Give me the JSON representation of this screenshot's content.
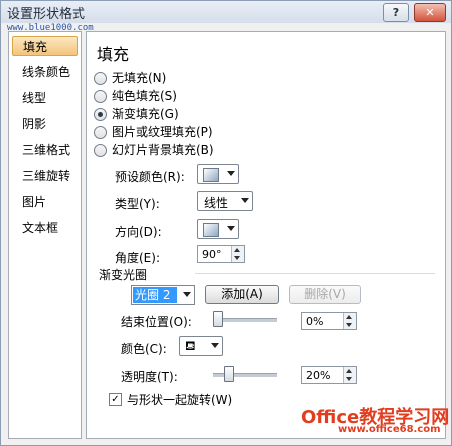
{
  "window": {
    "title": "设置形状格式",
    "url": "www.blue1000.com"
  },
  "titlebar": {
    "help": "?",
    "close": "✕"
  },
  "nav": {
    "items": [
      {
        "label": "填充",
        "selected": true
      },
      {
        "label": "线条颜色"
      },
      {
        "label": "线型"
      },
      {
        "label": "阴影"
      },
      {
        "label": "三维格式"
      },
      {
        "label": "三维旋转"
      },
      {
        "label": "图片"
      },
      {
        "label": "文本框"
      }
    ]
  },
  "panel": {
    "title": "填充",
    "options": [
      {
        "label": "无填充(N)",
        "checked": false
      },
      {
        "label": "纯色填充(S)",
        "checked": false
      },
      {
        "label": "渐变填充(G)",
        "checked": true
      },
      {
        "label": "图片或纹理填充(P)",
        "checked": false
      },
      {
        "label": "幻灯片背景填充(B)",
        "checked": false
      }
    ],
    "preset_color_label": "预设颜色(R):",
    "type_label": "类型(Y):",
    "type_value": "线性",
    "direction_label": "方向(D):",
    "angle_label": "角度(E):",
    "angle_value": "90°",
    "gradient_stops_label": "渐变光圈",
    "stop_value": "光圈 2",
    "add_button": "添加(A)",
    "delete_button": "删除(V)",
    "end_position_label": "结束位置(O):",
    "end_position_value": "0%",
    "end_position_fraction": 0.0,
    "color_label": "颜色(C):",
    "transparency_label": "透明度(T):",
    "transparency_value": "20%",
    "transparency_fraction": 0.2,
    "rotate_label": "与形状一起旋转(W)",
    "rotate_checked": true
  },
  "watermark": {
    "brand": "Office教程学习网",
    "url": "www.office68.com"
  }
}
